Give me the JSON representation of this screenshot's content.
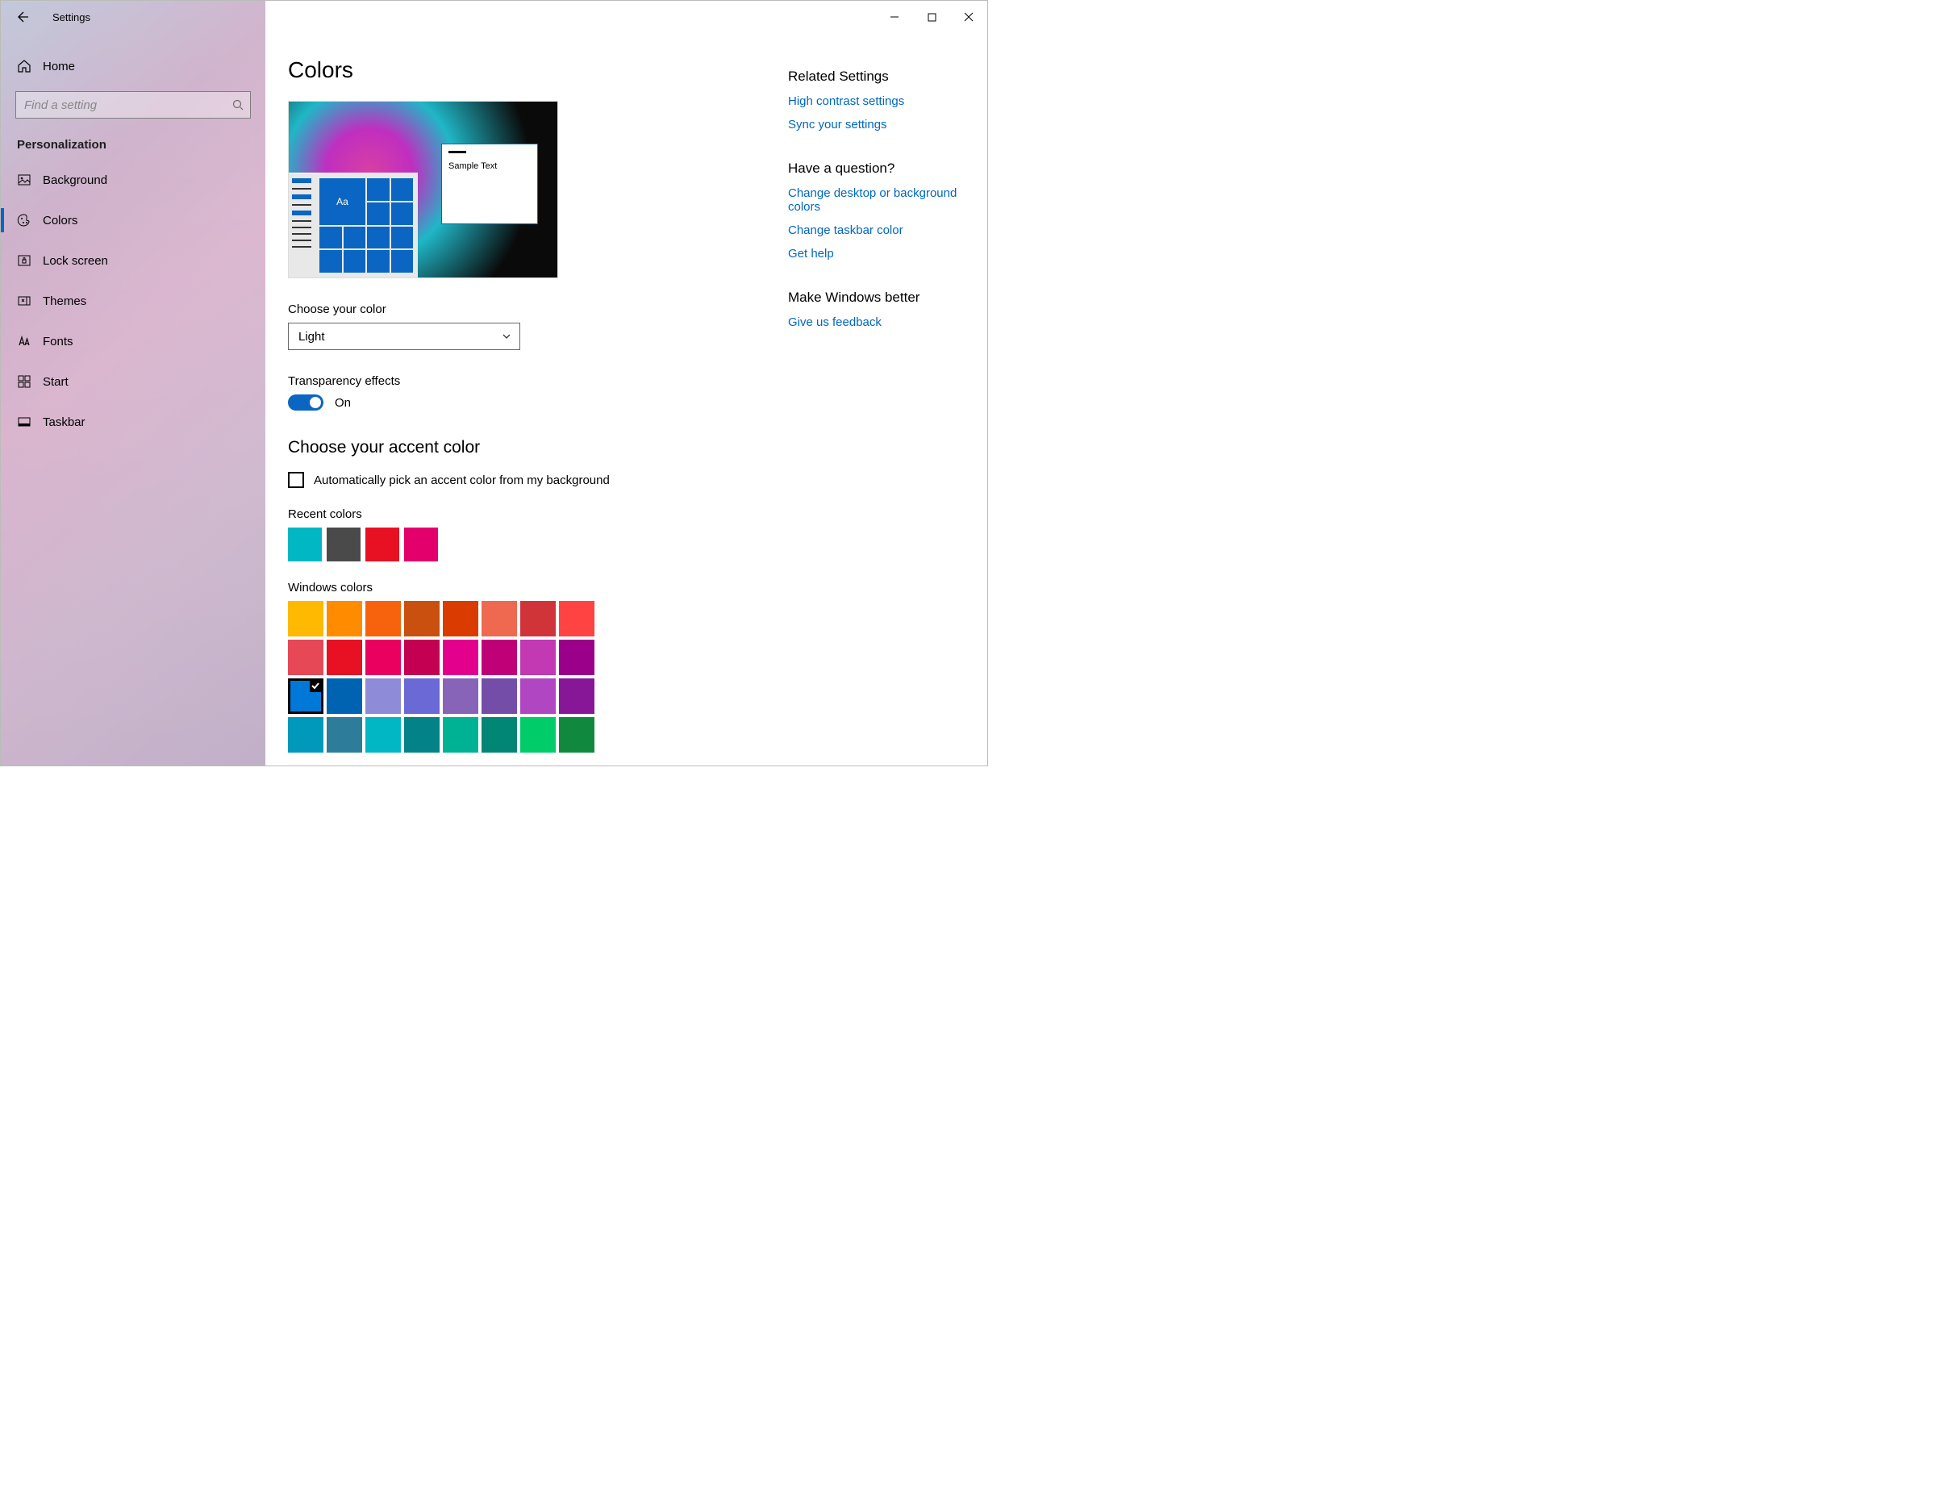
{
  "window": {
    "title": "Settings"
  },
  "sidebar": {
    "home_label": "Home",
    "search_placeholder": "Find a setting",
    "category": "Personalization",
    "items": [
      {
        "label": "Background",
        "icon": "image-icon",
        "selected": false
      },
      {
        "label": "Colors",
        "icon": "palette-icon",
        "selected": true
      },
      {
        "label": "Lock screen",
        "icon": "lock-screen-icon",
        "selected": false
      },
      {
        "label": "Themes",
        "icon": "themes-icon",
        "selected": false
      },
      {
        "label": "Fonts",
        "icon": "fonts-icon",
        "selected": false
      },
      {
        "label": "Start",
        "icon": "start-icon",
        "selected": false
      },
      {
        "label": "Taskbar",
        "icon": "taskbar-icon",
        "selected": false
      }
    ]
  },
  "page": {
    "title": "Colors",
    "preview": {
      "sample_text": "Sample Text",
      "tile_text": "Aa"
    },
    "choose_color_label": "Choose your color",
    "choose_color_value": "Light",
    "transparency_label": "Transparency effects",
    "transparency_state": "On",
    "accent_heading": "Choose your accent color",
    "auto_accent_label": "Automatically pick an accent color from my background",
    "auto_accent_checked": false,
    "recent_label": "Recent colors",
    "recent_colors": [
      "#00b7c3",
      "#4a4a4a",
      "#e81123",
      "#e3006d"
    ],
    "windows_label": "Windows colors",
    "windows_colors": [
      "#ffb900",
      "#ff8c00",
      "#f7630c",
      "#ca5010",
      "#da3b01",
      "#ef6950",
      "#d13438",
      "#ff4343",
      "#e74856",
      "#e81123",
      "#ea005e",
      "#c30052",
      "#e3008c",
      "#bf0077",
      "#c239b3",
      "#9a0089",
      "#0078d7",
      "#0063b1",
      "#8e8cd8",
      "#6b69d6",
      "#8764b8",
      "#744da9",
      "#b146c2",
      "#881798",
      "#0099bc",
      "#2d7d9a",
      "#00b7c3",
      "#038387",
      "#00b294",
      "#018574",
      "#00cc6a",
      "#10893e"
    ],
    "selected_color_index": 16
  },
  "aside": {
    "related_heading": "Related Settings",
    "related_links": [
      "High contrast settings",
      "Sync your settings"
    ],
    "question_heading": "Have a question?",
    "question_links": [
      "Change desktop or background colors",
      "Change taskbar color",
      "Get help"
    ],
    "better_heading": "Make Windows better",
    "better_links": [
      "Give us feedback"
    ]
  }
}
